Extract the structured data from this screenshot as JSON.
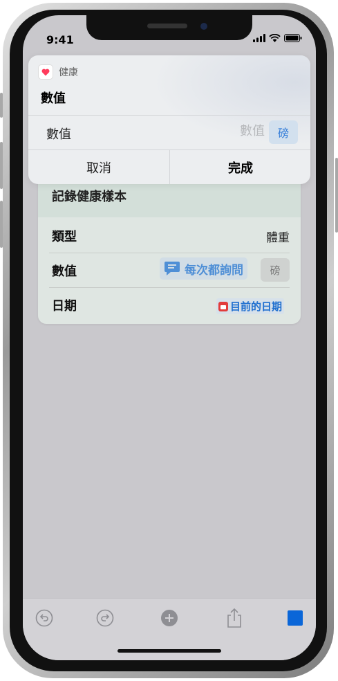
{
  "status_bar": {
    "time": "9:41"
  },
  "prompt": {
    "app_name": "健康",
    "title": "數值",
    "field_label": "數值",
    "field_placeholder": "數值",
    "unit": "磅",
    "cancel_label": "取消",
    "done_label": "完成"
  },
  "action_card": {
    "title": "記錄健康樣本",
    "rows": [
      {
        "label": "類型",
        "value": "體重"
      },
      {
        "label": "數值",
        "ask_label": "每次都詢問",
        "unit": "磅"
      },
      {
        "label": "日期",
        "date_label": "目前的日期"
      }
    ]
  },
  "toolbar": {
    "icons": [
      "undo-icon",
      "redo-icon",
      "add-icon",
      "share-icon",
      "play-icon"
    ]
  },
  "colors": {
    "accent": "#1f6fcf",
    "unit_chip_bg": "#d2e0ee",
    "health_heart": "#ff3b5c",
    "calendar_red": "#e23b3b"
  }
}
